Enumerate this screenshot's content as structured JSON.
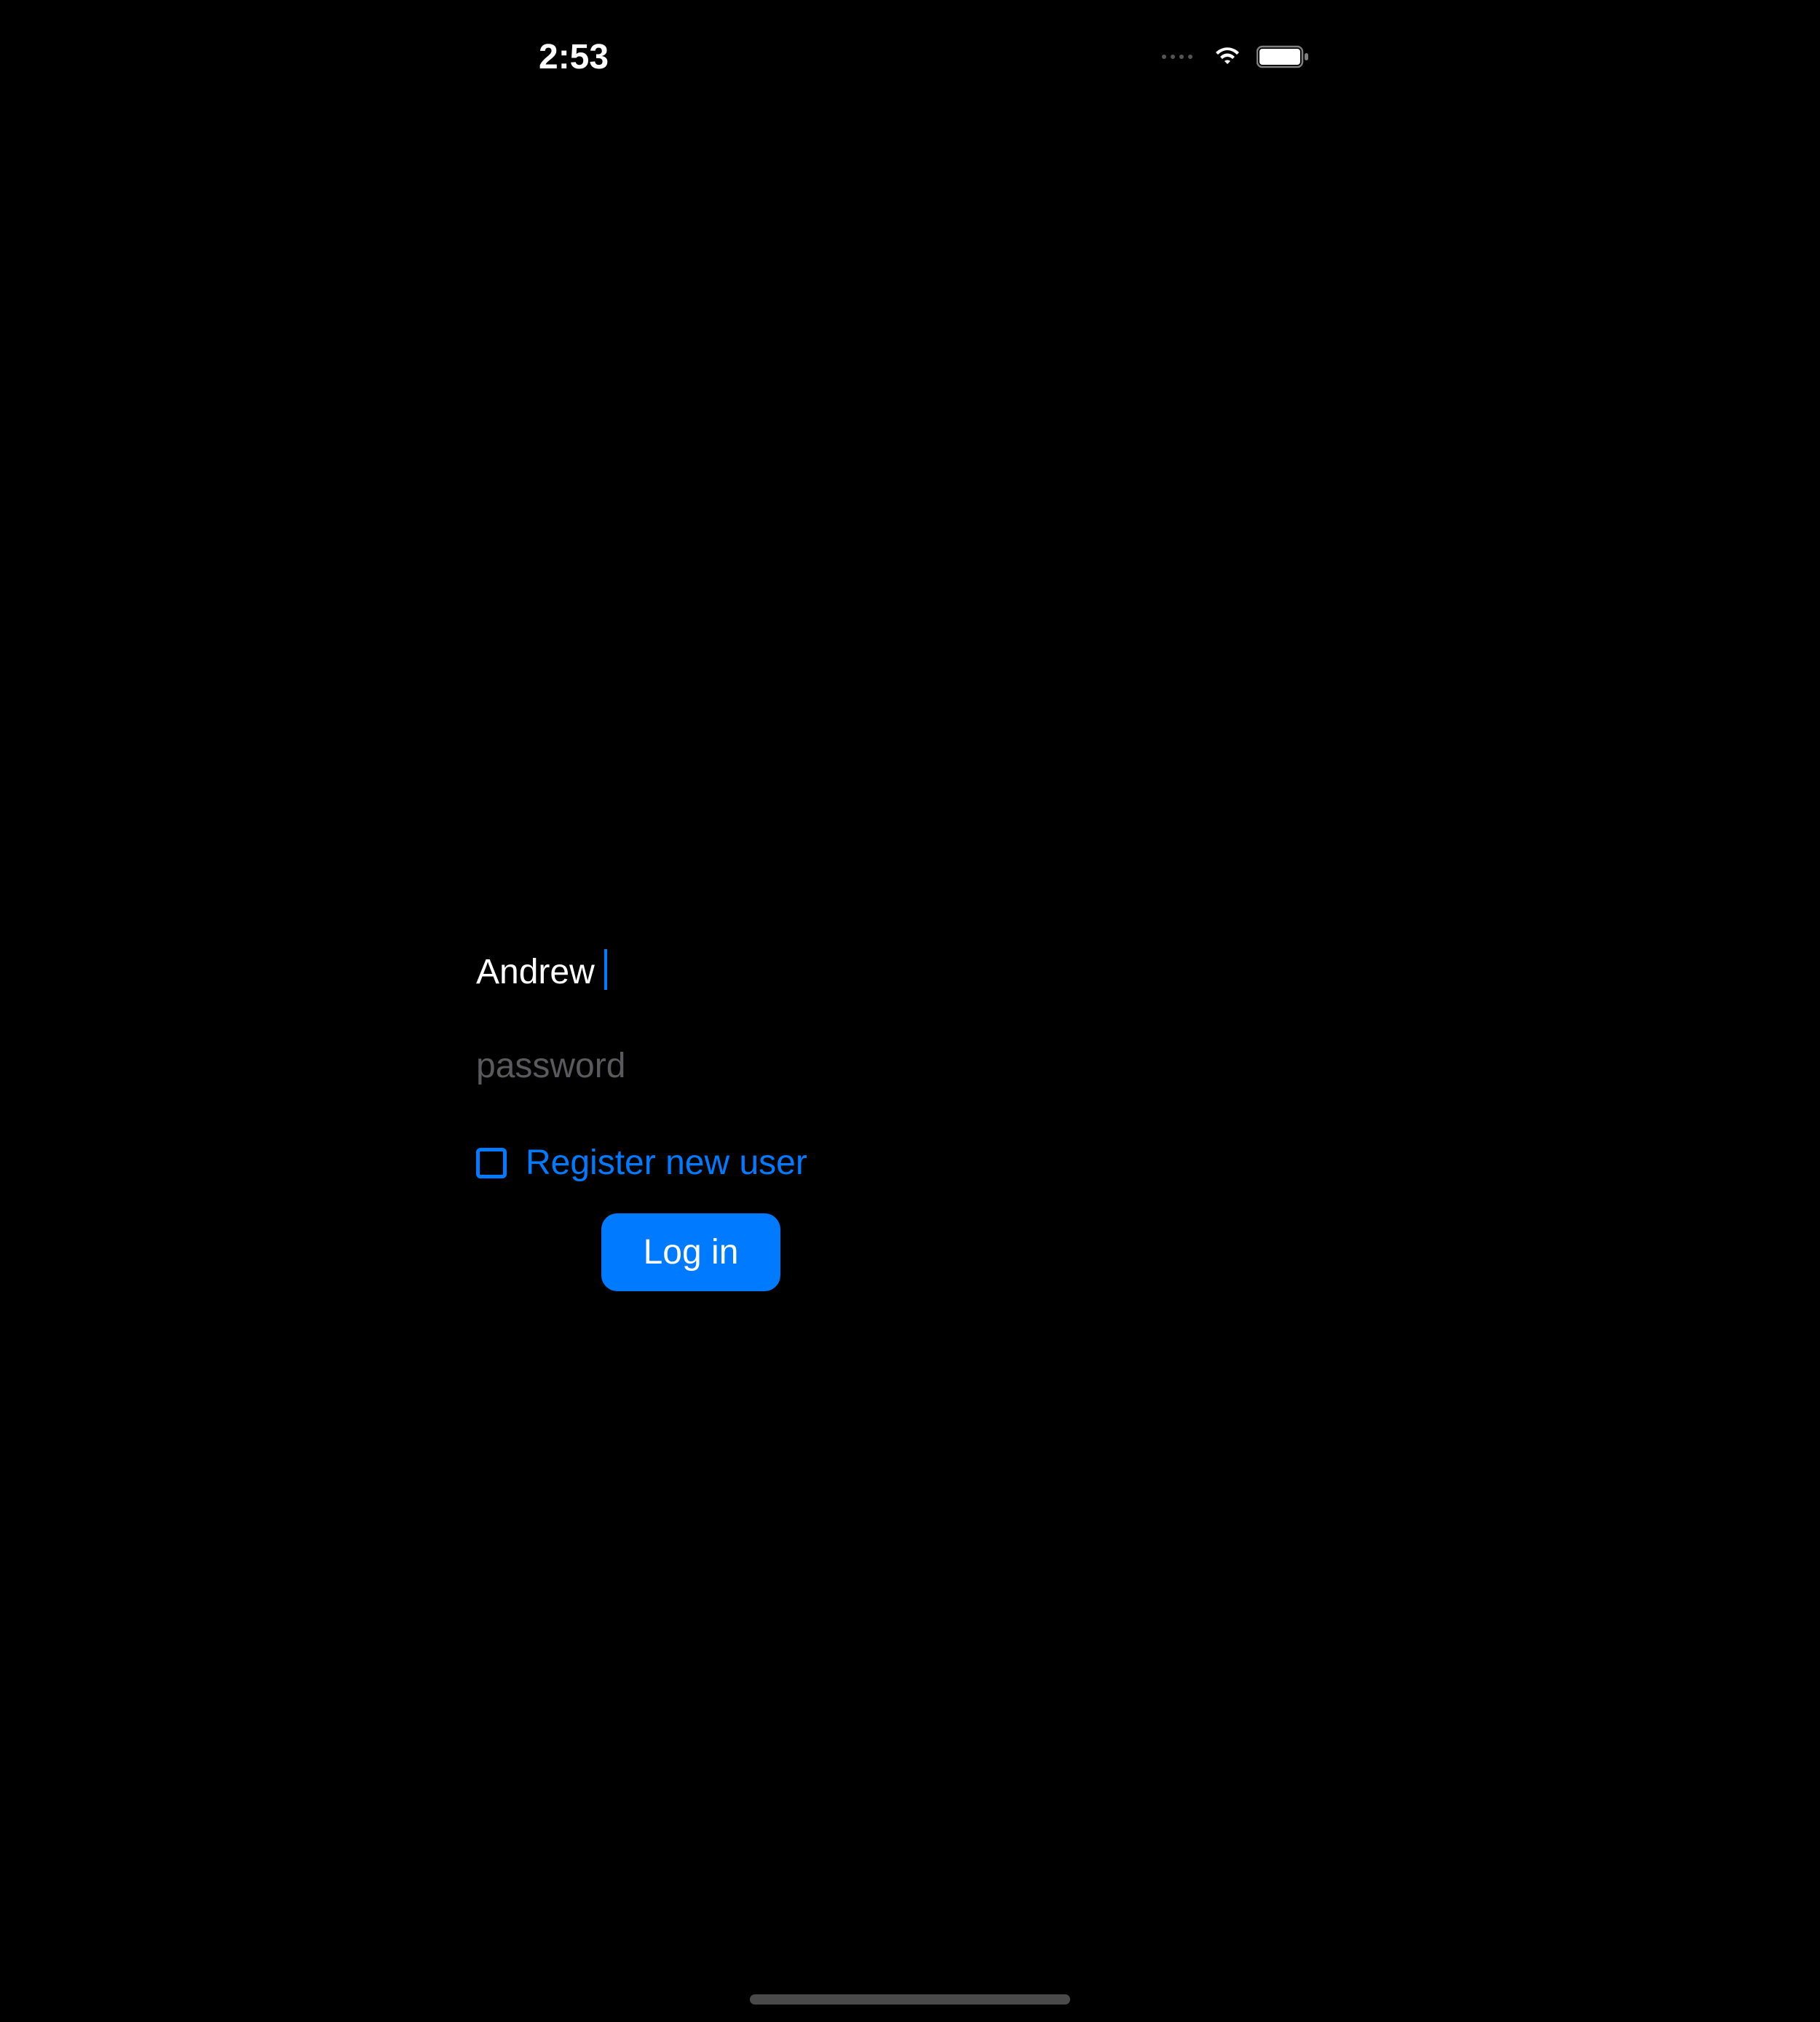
{
  "statusBar": {
    "time": "2:53"
  },
  "form": {
    "usernameValue": "Andrew",
    "passwordPlaceholder": "password",
    "passwordValue": "",
    "registerLabel": "Register new user",
    "loginButtonLabel": "Log in"
  },
  "colors": {
    "accent": "#007AFF",
    "background": "#000000",
    "placeholderText": "#5a5a5e"
  }
}
